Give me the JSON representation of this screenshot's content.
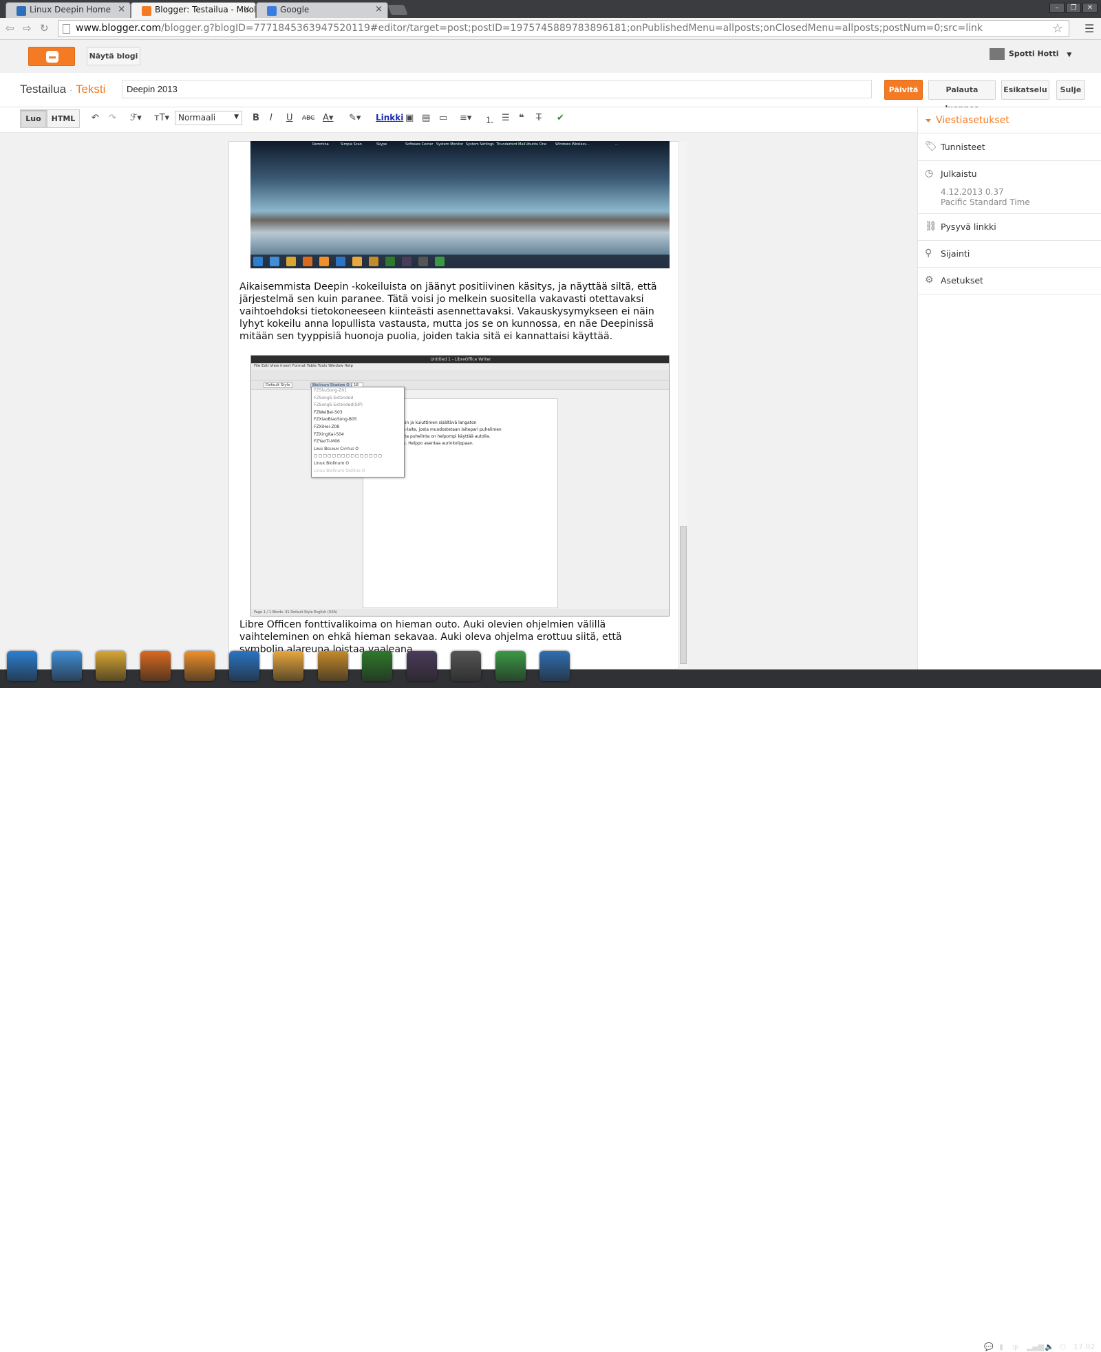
{
  "browser": {
    "tabs": [
      {
        "label": "Linux Deepin Home",
        "favicon_color": "#2f6fb9",
        "active": false
      },
      {
        "label": "Blogger: Testailua - Muok",
        "favicon_color": "#f47b23",
        "active": true
      },
      {
        "label": "Google",
        "favicon_color": "#3a7de0",
        "active": false
      }
    ],
    "url_host": "www.blogger.com",
    "url_path": "/blogger.g?blogID=7771845363947520119#editor/target=post;postID=1975745889783896181;onPublishedMenu=allposts;onClosedMenu=allposts;postNum=0;src=link"
  },
  "blogger": {
    "view_blog_button": "Näytä blogi",
    "user_name": "Spotti Hotti",
    "breadcrumb_blog": "Testailua",
    "breadcrumb_separator": "·",
    "breadcrumb_section": "Teksti",
    "post_title_value": "Deepin 2013",
    "actions": {
      "update": "Päivitä",
      "revert_draft": "Palauta luonnos",
      "preview": "Esikatselu",
      "close": "Sulje"
    },
    "toolbar": {
      "compose": "Luo",
      "html": "HTML",
      "format_select": "Normaali",
      "link": "Linkki"
    }
  },
  "post": {
    "image1_labels": [
      "Remmina",
      "Simple Scan",
      "Skype",
      "Software Center",
      "System Monitor",
      "System Settings",
      "Thunderbird Mail",
      "Ubuntu One",
      "Windows Wireless",
      "...",
      "..."
    ],
    "paragraph1": "Aikaisemmista Deepin -kokeiluista on jäänyt positiivinen käsitys, ja näyttää siltä, että järjestelmä sen kuin paranee. Tätä voisi jo melkein suositella vakavasti otettavaksi vaihtoehdoksi tietokoneeseen kiinteästi asennettavaksi. Vakauskysymykseen ei näin lyhyt kokeilu anna lopullista vastausta, mutta jos se on kunnossa, en näe Deepinissä mitään sen tyyppisiä huonoja puolia, joiden takia sitä ei kannattaisi käyttää.",
    "image2": {
      "window_title": "Untitled 1 - LibreOffice Writer",
      "menu": "File   Edit   View   Insert   Format   Table   Tools   Window   Help",
      "style_box": "Default Style",
      "font_box": "Biolinum Shadow O",
      "size_box": "18",
      "font_list": [
        "FZShuSong-Z01",
        "FZSongS-Extended",
        "FZSongS-Extended(SIP)",
        "FZWeiBei-S03",
        "FZXiaoBiaoSong-B05",
        "FZXiHei-Z08",
        "FZXingKai-S04",
        "FZYaoTi-M06",
        "Linux Biolinum Capitals O",
        "Linux Biolinum O",
        "Linux Biolinum Outline O"
      ],
      "page_text": [
        "...sin ja kuiuttimen sisältävä langaton",
        "...h-laite, josta muodostetaan laitepari puhelimen",
        "...tta puhelinta on helpompi käyttää autolla.",
        "...a. Helppo asentaa aurinkolippaan."
      ],
      "status_bar": "Page 1 / 1     Words: 31     Default Style     English (USA)"
    },
    "paragraph2": "Libre Officen fonttivalikoima on hieman outo. Auki olevien ohjelmien välillä vaihteleminen on ehkä hieman sekavaa. Auki oleva ohjelma erottuu siitä, että symbolin alareuna loistaa vaaleana."
  },
  "sidebar": {
    "heading": "Viestiasetukset",
    "labels": "Tunnisteet",
    "published": "Julkaistu",
    "published_date": "4.12.2013 0.37",
    "published_tz": "Pacific Standard Time",
    "permalink": "Pysyvä linkki",
    "location": "Sijainti",
    "settings": "Asetukset"
  },
  "taskbar": {
    "clock": "17.02",
    "dock_apps": [
      {
        "name": "deepin-launcher",
        "color": "#2b7fd1"
      },
      {
        "name": "desktop",
        "color": "#3f8fd8"
      },
      {
        "name": "file-manager",
        "color": "#d9a632"
      },
      {
        "name": "firefox",
        "color": "#d96a1e"
      },
      {
        "name": "deepin-music",
        "color": "#f0902a"
      },
      {
        "name": "deepin-terminal",
        "color": "#2a74c4"
      },
      {
        "name": "software-center",
        "color": "#e9a83d"
      },
      {
        "name": "games",
        "color": "#c58b2a"
      },
      {
        "name": "image-viewer",
        "color": "#2d7a2a"
      },
      {
        "name": "deepin-emacs",
        "color": "#4a3b5a"
      },
      {
        "name": "system-settings",
        "color": "#555555"
      },
      {
        "name": "chrome",
        "color": "#3a9a44"
      },
      {
        "name": "libreoffice-writer",
        "color": "#2f6fb3"
      }
    ]
  },
  "colors": {
    "accent": "#f47b23",
    "link": "#1a2cb0"
  }
}
